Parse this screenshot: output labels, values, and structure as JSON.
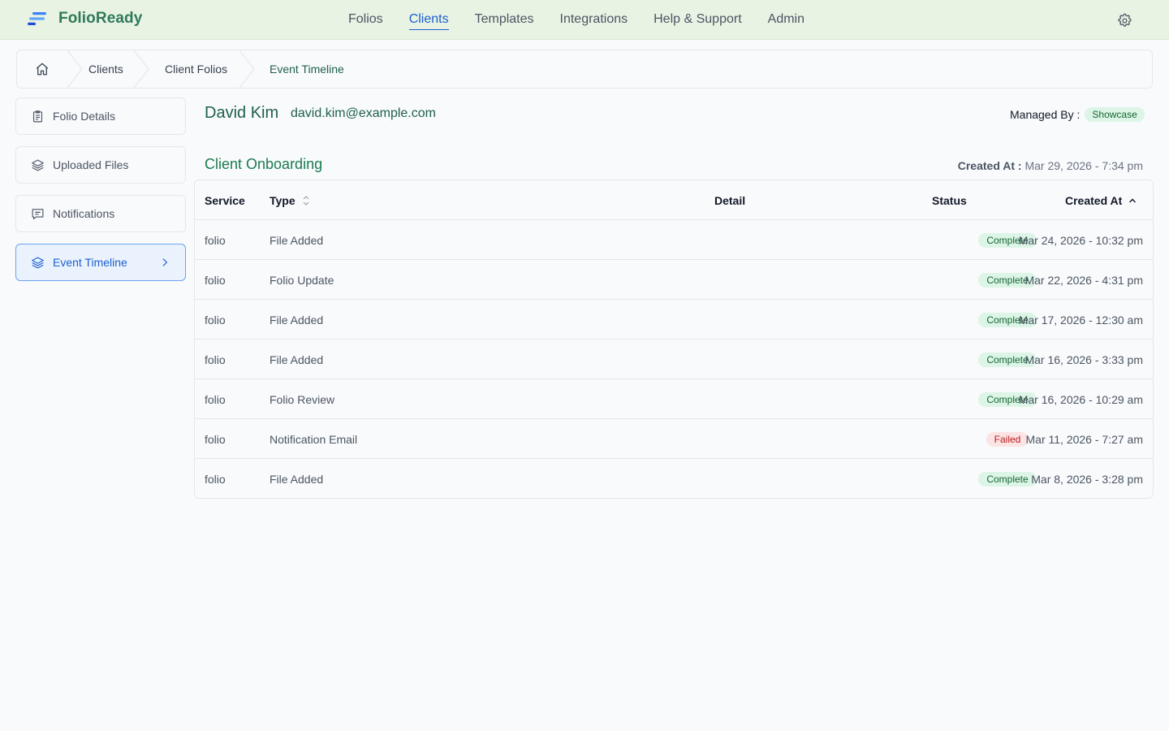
{
  "brand": {
    "name": "FolioReady",
    "accent": "#2f7a5a"
  },
  "nav": {
    "items": [
      {
        "label": "Folios"
      },
      {
        "label": "Clients",
        "active": true
      },
      {
        "label": "Templates"
      },
      {
        "label": "Integrations"
      },
      {
        "label": "Help & Support"
      },
      {
        "label": "Admin"
      }
    ],
    "settings_icon": "gear-icon"
  },
  "breadcrumb": {
    "home_icon": "home-icon",
    "items": [
      "Clients",
      "Client Folios",
      "Event Timeline"
    ]
  },
  "sidebar": {
    "items": [
      {
        "label": "Folio Details",
        "icon": "clipboard-icon"
      },
      {
        "label": "Uploaded Files",
        "icon": "layers-icon"
      },
      {
        "label": "Notifications",
        "icon": "message-icon"
      },
      {
        "label": "Event Timeline",
        "icon": "layers-icon",
        "active": true
      }
    ]
  },
  "client": {
    "name": "David Kim",
    "email": "david.kim@example.com",
    "managed_by_label": "Managed By :",
    "managed_by_value": "Showcase"
  },
  "section": {
    "title": "Client Onboarding",
    "created_label": "Created At :",
    "created_value": "Mar 29, 2026 - 7:34 pm"
  },
  "table": {
    "headers": {
      "service": "Service",
      "type": "Type",
      "detail": "Detail",
      "status": "Status",
      "created": "Created At"
    },
    "rows": [
      {
        "service": "folio",
        "type": "File Added",
        "detail": "",
        "status": "Complete",
        "created": "Mar 24, 2026 - 10:32 pm"
      },
      {
        "service": "folio",
        "type": "Folio Update",
        "detail": "",
        "status": "Complete",
        "created": "Mar 22, 2026 - 4:31 pm"
      },
      {
        "service": "folio",
        "type": "File Added",
        "detail": "",
        "status": "Complete",
        "created": "Mar 17, 2026 - 12:30 am"
      },
      {
        "service": "folio",
        "type": "File Added",
        "detail": "",
        "status": "Complete",
        "created": "Mar 16, 2026 - 3:33 pm"
      },
      {
        "service": "folio",
        "type": "Folio Review",
        "detail": "",
        "status": "Complete",
        "created": "Mar 16, 2026 - 10:29 am"
      },
      {
        "service": "folio",
        "type": "Notification Email",
        "detail": "",
        "status": "Failed",
        "created": "Mar 11, 2026 - 7:27 am"
      },
      {
        "service": "folio",
        "type": "File Added",
        "detail": "",
        "status": "Complete",
        "created": "Mar 8, 2026 - 3:28 pm"
      }
    ]
  },
  "colors": {
    "complete": "#166534",
    "failed": "#b91c1c",
    "link": "#1d5fd1"
  }
}
